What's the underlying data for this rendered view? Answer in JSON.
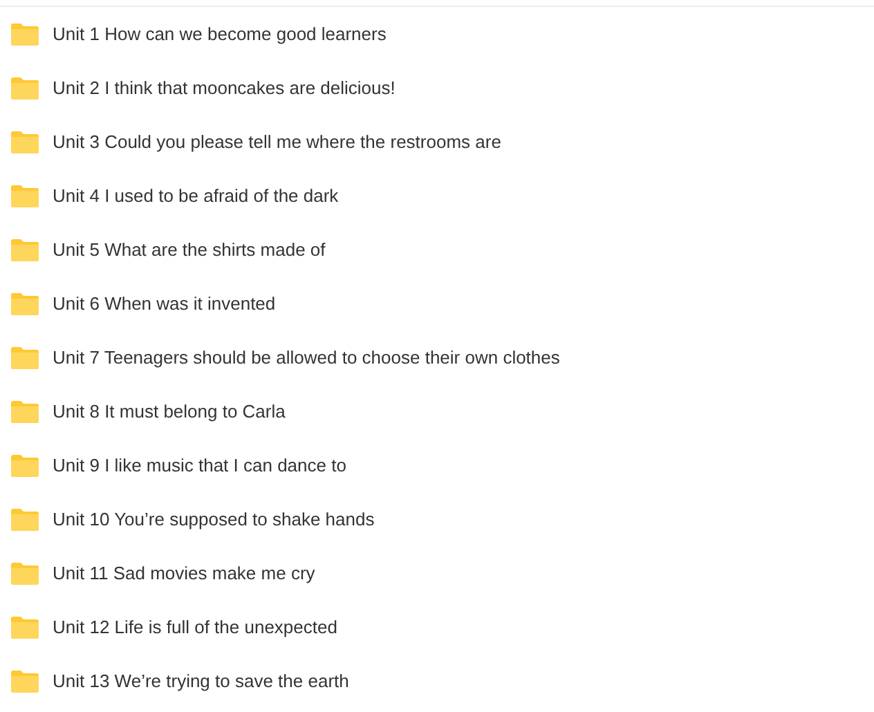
{
  "folders": [
    {
      "name": "Unit 1 How can we become good learners"
    },
    {
      "name": "Unit 2 I think that mooncakes are delicious!"
    },
    {
      "name": "Unit 3 Could you please tell me where the restrooms are"
    },
    {
      "name": "Unit 4 I used to be afraid of the dark"
    },
    {
      "name": "Unit 5 What are the shirts made of"
    },
    {
      "name": "Unit 6 When was it invented"
    },
    {
      "name": "Unit 7 Teenagers should be allowed to choose their own clothes"
    },
    {
      "name": "Unit 8 It must belong to Carla"
    },
    {
      "name": "Unit 9 I like music that I can dance to"
    },
    {
      "name": "Unit 10 You’re supposed to shake hands"
    },
    {
      "name": "Unit 11 Sad movies make me cry"
    },
    {
      "name": "Unit 12 Life is full of the unexpected"
    },
    {
      "name": "Unit 13 We’re trying to save the earth"
    }
  ]
}
